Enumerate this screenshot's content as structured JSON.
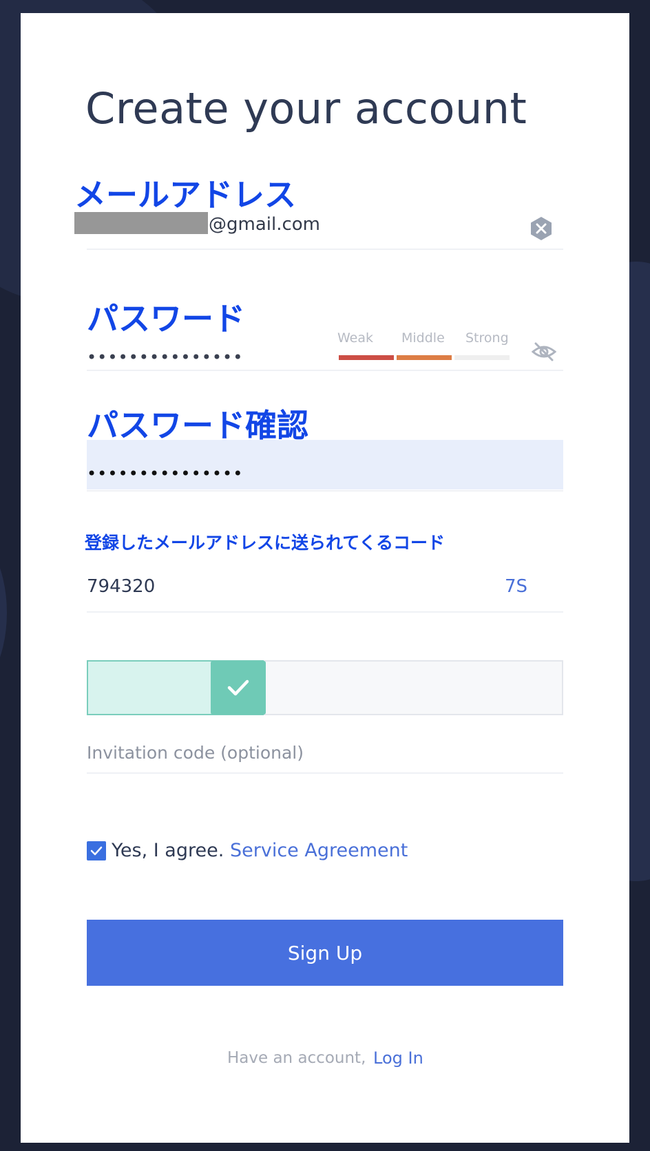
{
  "page": {
    "title": "Create your account"
  },
  "email": {
    "label": "メールアドレス",
    "domain": "@gmail.com",
    "clear_icon": "clear-x-icon"
  },
  "password": {
    "label": "パスワード",
    "masked_value": "•••••••••••••••",
    "strength": {
      "labels": [
        "Weak",
        "Middle",
        "Strong"
      ],
      "level": "Middle",
      "colors": [
        "#cc4e45",
        "#dd7d45",
        "#efefef"
      ]
    },
    "visibility_icon": "eye-off-icon"
  },
  "password_confirm": {
    "label": "パスワード確認",
    "masked_value": "•••••••••••••••"
  },
  "verification": {
    "label": "登録したメールアドレスに送られてくるコード",
    "value": "794320",
    "countdown": "7S"
  },
  "slider": {
    "status": "verified",
    "icon": "check-icon",
    "accent_color": "#6fcab6"
  },
  "invitation": {
    "placeholder": "Invitation code (optional)"
  },
  "agreement": {
    "checked": true,
    "text": "Yes, I agree.",
    "link": "Service Agreement"
  },
  "signup": {
    "button_label": "Sign Up",
    "color": "#4770df"
  },
  "footer": {
    "prompt": "Have an account,",
    "login_link": "Log In"
  }
}
